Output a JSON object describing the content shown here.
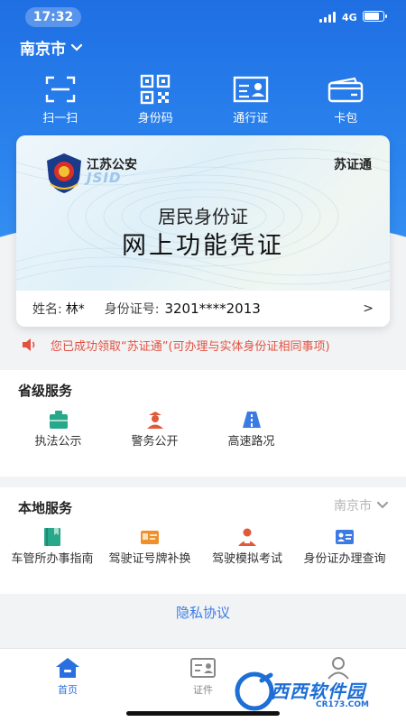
{
  "status_bar": {
    "time": "17:32",
    "network": "4G",
    "battery_level": 0.85
  },
  "header": {
    "city": "南京市"
  },
  "quick_actions": [
    {
      "label": "扫一扫",
      "icon": "scan-icon"
    },
    {
      "label": "身份码",
      "icon": "qr-code-icon"
    },
    {
      "label": "通行证",
      "icon": "pass-card-icon"
    },
    {
      "label": "卡包",
      "icon": "wallet-icon"
    }
  ],
  "id_card": {
    "issuer": "江苏公安",
    "issuer_sub": "JSID",
    "brand": "苏证通",
    "title_line1": "居民身份证",
    "title_line2": "网上功能凭证",
    "name_label": "姓名:",
    "name_value": "林*",
    "id_label": "身份证号:",
    "id_value": "3201****2013",
    "arrow": ">"
  },
  "notice": {
    "text": "您已成功领取“苏证通”(可办理与实体身份证相同事项)",
    "icon": "speaker-icon"
  },
  "provincial_services": {
    "title": "省级服务",
    "items": [
      {
        "label": "执法公示",
        "icon": "briefcase-icon"
      },
      {
        "label": "警务公开",
        "icon": "police-officer-icon"
      },
      {
        "label": "高速路况",
        "icon": "highway-icon"
      }
    ]
  },
  "local_services": {
    "title": "本地服务",
    "city_selector": "南京市",
    "items": [
      {
        "label": "车管所办事指南",
        "icon": "guide-book-icon"
      },
      {
        "label": "驾驶证号牌补换",
        "icon": "license-card-icon"
      },
      {
        "label": "驾驶模拟考试",
        "icon": "driver-exam-icon"
      },
      {
        "label": "身份证办理查询",
        "icon": "id-query-icon"
      }
    ]
  },
  "privacy_link": "隐私协议",
  "tabbar": [
    {
      "label": "首页",
      "icon": "home-icon",
      "active": true
    },
    {
      "label": "证件",
      "icon": "certificate-icon",
      "active": false
    },
    {
      "label": "",
      "icon": "profile-icon",
      "active": false
    }
  ],
  "watermark": {
    "text": "西西软件园",
    "site": "CR173.COM"
  },
  "colors": {
    "primary": "#2a6fe0",
    "header_top": "#1f6fe3",
    "notice_red": "#e25241",
    "teal": "#27a88a",
    "orange": "#f0902a"
  }
}
